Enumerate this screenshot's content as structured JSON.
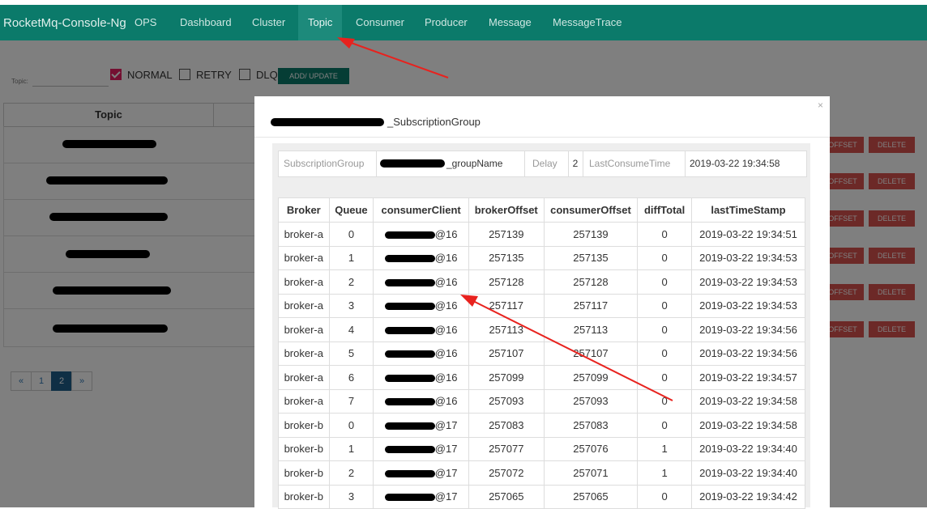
{
  "app": {
    "brand": "RocketMq-Console-Ng",
    "nav": [
      "OPS",
      "Dashboard",
      "Cluster",
      "Topic",
      "Consumer",
      "Producer",
      "Message",
      "MessageTrace"
    ],
    "active_nav": "Topic"
  },
  "filter": {
    "topic_label": "Topic:",
    "topic_value": "",
    "checkboxes": [
      {
        "label": "NORMAL",
        "checked": true
      },
      {
        "label": "RETRY",
        "checked": false
      },
      {
        "label": "DLQ",
        "checked": false
      }
    ],
    "add_update_label": "ADD/ UPDATE"
  },
  "topics_table": {
    "header": "Topic",
    "rows": [
      {
        "text_visible": "",
        "buttons": [
          "OFFSET",
          "DELETE"
        ]
      },
      {
        "text_visible": "_monitor_topic",
        "buttons": [
          "OFFSET",
          "DELETE"
        ]
      },
      {
        "text_visible": "_monit_ic_sxzys",
        "buttons": [
          "OFFSET",
          "DELETE"
        ]
      },
      {
        "text_visible": "_blic_topic",
        "buttons": [
          "OFFSET",
          "DELETE"
        ]
      },
      {
        "text_visible": "_topic_sxzyh",
        "buttons": [
          "OFFSET",
          "DELETE"
        ]
      },
      {
        "text_visible": "_blic_topic_sxzys",
        "buttons": [
          "OFFSET",
          "DELETE"
        ]
      }
    ]
  },
  "pagination": {
    "prev": "«",
    "pages": [
      "1",
      "2"
    ],
    "active": "2",
    "next": "»"
  },
  "modal": {
    "title": "_SubscriptionGroup",
    "close": "×",
    "info": {
      "group_label": "SubscriptionGroup",
      "group_value": "_groupName",
      "delay_label": "Delay",
      "delay_value": "2",
      "last_label": "LastConsumeTime",
      "last_value": "2019-03-22 19:34:58"
    },
    "columns": [
      "Broker",
      "Queue",
      "consumerClient",
      "brokerOffset",
      "consumerOffset",
      "diffTotal",
      "lastTimeStamp"
    ],
    "rows": [
      {
        "broker": "broker-a",
        "queue": "0",
        "client": "@16",
        "brokerOffset": "257139",
        "consumerOffset": "257139",
        "diff": "0",
        "ts": "2019-03-22 19:34:51"
      },
      {
        "broker": "broker-a",
        "queue": "1",
        "client": "@16",
        "brokerOffset": "257135",
        "consumerOffset": "257135",
        "diff": "0",
        "ts": "2019-03-22 19:34:53"
      },
      {
        "broker": "broker-a",
        "queue": "2",
        "client": "@16",
        "brokerOffset": "257128",
        "consumerOffset": "257128",
        "diff": "0",
        "ts": "2019-03-22 19:34:53"
      },
      {
        "broker": "broker-a",
        "queue": "3",
        "client": "@16",
        "brokerOffset": "257117",
        "consumerOffset": "257117",
        "diff": "0",
        "ts": "2019-03-22 19:34:53"
      },
      {
        "broker": "broker-a",
        "queue": "4",
        "client": "@16",
        "brokerOffset": "257113",
        "consumerOffset": "257113",
        "diff": "0",
        "ts": "2019-03-22 19:34:56"
      },
      {
        "broker": "broker-a",
        "queue": "5",
        "client": "@16",
        "brokerOffset": "257107",
        "consumerOffset": "257107",
        "diff": "0",
        "ts": "2019-03-22 19:34:56"
      },
      {
        "broker": "broker-a",
        "queue": "6",
        "client": "@16",
        "brokerOffset": "257099",
        "consumerOffset": "257099",
        "diff": "0",
        "ts": "2019-03-22 19:34:57"
      },
      {
        "broker": "broker-a",
        "queue": "7",
        "client": "@16",
        "brokerOffset": "257093",
        "consumerOffset": "257093",
        "diff": "0",
        "ts": "2019-03-22 19:34:58"
      },
      {
        "broker": "broker-b",
        "queue": "0",
        "client": "@17",
        "brokerOffset": "257083",
        "consumerOffset": "257083",
        "diff": "0",
        "ts": "2019-03-22 19:34:58"
      },
      {
        "broker": "broker-b",
        "queue": "1",
        "client": "@17",
        "brokerOffset": "257077",
        "consumerOffset": "257076",
        "diff": "1",
        "ts": "2019-03-22 19:34:40"
      },
      {
        "broker": "broker-b",
        "queue": "2",
        "client": "@17",
        "brokerOffset": "257072",
        "consumerOffset": "257071",
        "diff": "1",
        "ts": "2019-03-22 19:34:40"
      },
      {
        "broker": "broker-b",
        "queue": "3",
        "client": "@17",
        "brokerOffset": "257065",
        "consumerOffset": "257065",
        "diff": "0",
        "ts": "2019-03-22 19:34:42"
      }
    ]
  },
  "colors": {
    "navbar": "#0b7a6a",
    "checkbox_checked": "#e91e63",
    "danger": "#d9534f",
    "annotation_arrow": "#e8221e"
  }
}
